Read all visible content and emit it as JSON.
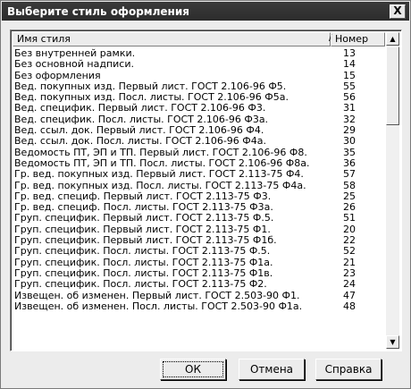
{
  "window": {
    "title": "Выберите стиль оформления",
    "close_label": "X"
  },
  "list": {
    "columns": {
      "name": "Имя стиля",
      "number": "Номер",
      "sort_indicator": "/"
    },
    "rows": [
      {
        "name": "Без внутренней рамки.",
        "number": "13"
      },
      {
        "name": "Без основной надписи.",
        "number": "14"
      },
      {
        "name": "Без оформления",
        "number": "15"
      },
      {
        "name": "Вед. покупных изд. Первый лист. ГОСТ 2.106-96 Ф5.",
        "number": "55"
      },
      {
        "name": "Вед. покупных изд. Посл. листы. ГОСТ 2.106-96 Ф5а.",
        "number": "56"
      },
      {
        "name": "Вед. специфик. Первый лист. ГОСТ 2.106-96 Ф3.",
        "number": "31"
      },
      {
        "name": "Вед. специфик. Посл. листы. ГОСТ 2.106-96 Ф3а.",
        "number": "32"
      },
      {
        "name": "Вед. ссыл. док. Первый лист. ГОСТ 2.106-96 Ф4.",
        "number": "29"
      },
      {
        "name": "Вед. ссыл. док. Посл. листы. ГОСТ 2.106-96 Ф4а.",
        "number": "30"
      },
      {
        "name": "Ведомость ПТ, ЭП и ТП. Первый лист. ГОСТ 2.106-96 Ф8.",
        "number": "35"
      },
      {
        "name": "Ведомость ПТ, ЭП и ТП. Посл. листы. ГОСТ 2.106-96 Ф8а.",
        "number": "36"
      },
      {
        "name": "Гр. вед. покупных изд. Первый лист. ГОСТ 2.113-75 Ф4.",
        "number": "57"
      },
      {
        "name": "Гр. вед. покупных изд. Посл. листы. ГОСТ 2.113-75 Ф4а.",
        "number": "58"
      },
      {
        "name": "Гр. вед. специф. Первый лист. ГОСТ 2.113-75 Ф3.",
        "number": "25"
      },
      {
        "name": "Гр. вед. специф. Посл. листы. ГОСТ 2.113-75 Ф3а.",
        "number": "26"
      },
      {
        "name": "Груп. специфик. Первый лист. ГОСТ 2.113-75 Ф.5.",
        "number": "51"
      },
      {
        "name": "Груп. специфик. Первый лист. ГОСТ 2.113-75 Ф1.",
        "number": "20"
      },
      {
        "name": "Груп. специфик. Первый лист. ГОСТ 2.113-75 Ф1б.",
        "number": "22"
      },
      {
        "name": "Груп. специфик. Посл. листы. ГОСТ 2.113-75 Ф.5.",
        "number": "52"
      },
      {
        "name": "Груп. специфик. Посл. листы. ГОСТ 2.113-75 Ф1а.",
        "number": "21"
      },
      {
        "name": "Груп. специфик. Посл. листы. ГОСТ 2.113-75 Ф1в.",
        "number": "23"
      },
      {
        "name": "Груп. специфик. Посл. листы. ГОСТ 2.113-75 Ф2.",
        "number": "24"
      },
      {
        "name": "Извещен. об изменен. Первый лист. ГОСТ 2.503-90 Ф1.",
        "number": "47"
      },
      {
        "name": "Извещен. об изменен. Посл. листы. ГОСТ 2.503-90 Ф1а.",
        "number": "48"
      }
    ]
  },
  "buttons": {
    "ok": "ОК",
    "cancel": "Отмена",
    "help": "Справка"
  }
}
